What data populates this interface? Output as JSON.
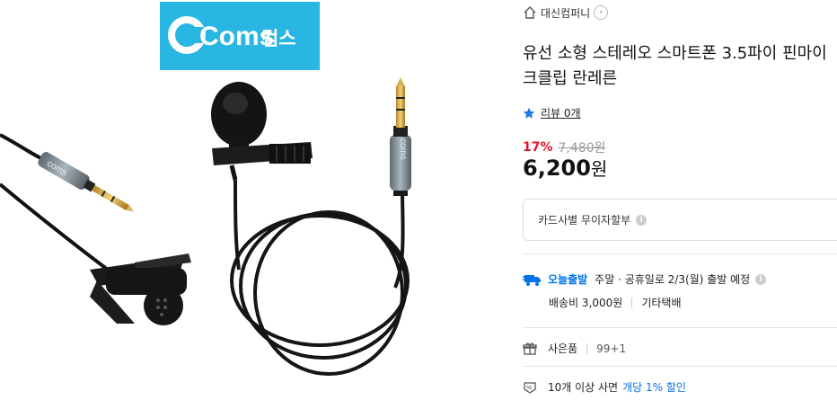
{
  "brand": {
    "logo_text": "Coms",
    "logo_korean": "컴스",
    "logo_bg": "#29b6e3"
  },
  "product_image": {
    "cable_brand_mark": "coms"
  },
  "store": {
    "home_icon": "home-icon",
    "name": "대신컴퍼니",
    "chevron": "›"
  },
  "product": {
    "title_line1": "유선 소형 스테레오 스마트폰 3.5파이 핀마이",
    "title_line2": "크클립 란레른"
  },
  "review": {
    "icon": "star-icon",
    "label": "리뷰 0개",
    "color": "#1e78e8"
  },
  "price": {
    "discount_rate": "17%",
    "original_price": "7,480원",
    "sale_amount": "6,200",
    "sale_unit": "원",
    "discount_color": "#e5152a"
  },
  "card_installment": {
    "label": "카드사별 무이자할부",
    "info_icon": "i"
  },
  "delivery": {
    "badge": "오늘출발",
    "text": "주말 · 공휴일로 2/3(월) 출발 예정",
    "info_icon": "i",
    "shipping_fee": "배송비 3,000원",
    "courier": "기타택배",
    "accent": "#0073e9"
  },
  "gift": {
    "label": "사은품",
    "value": "99+1"
  },
  "bulk_discount": {
    "prefix": "10개 이상 사면",
    "highlight": "개당 1% 할인"
  }
}
